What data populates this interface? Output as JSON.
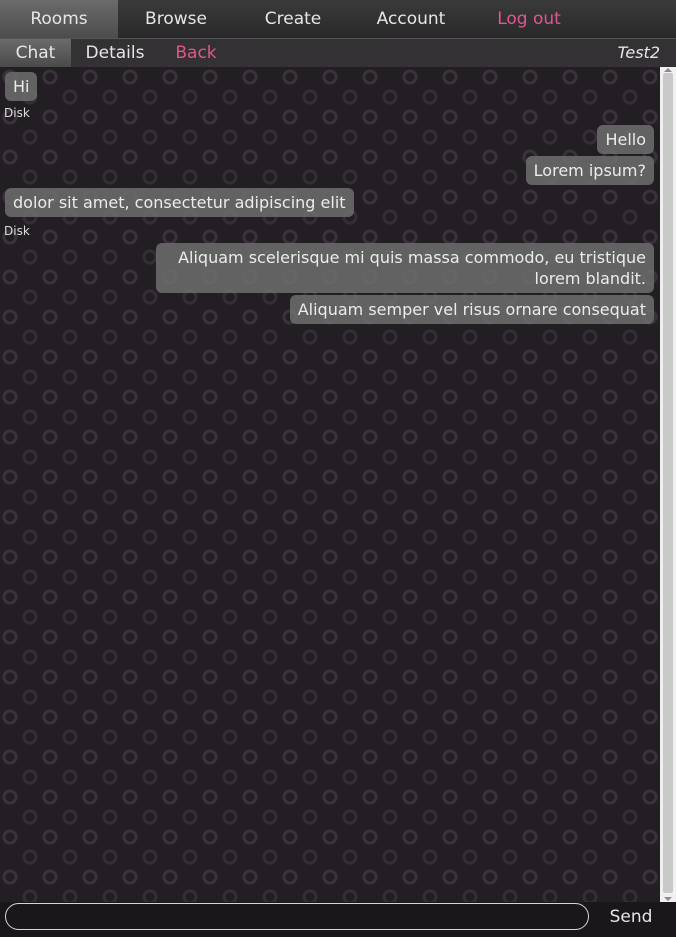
{
  "topnav": {
    "items": [
      "Rooms",
      "Browse",
      "Create",
      "Account"
    ],
    "logout_label": "Log out"
  },
  "subnav": {
    "chat_label": "Chat",
    "details_label": "Details",
    "back_label": "Back",
    "room_name": "Test2"
  },
  "messages": [
    {
      "text": "Hi",
      "side": "left",
      "sender": "Disk"
    },
    {
      "text": "Hello",
      "side": "right"
    },
    {
      "text": "Lorem ipsum?",
      "side": "right"
    },
    {
      "text": "dolor sit amet, consectetur adipiscing elit",
      "side": "left",
      "sender": "Disk"
    },
    {
      "text": "Aliquam scelerisque mi quis massa commodo, eu tristique lorem blandit.",
      "side": "right"
    },
    {
      "text": "Aliquam semper vel risus ornare consequat",
      "side": "right"
    }
  ],
  "input": {
    "placeholder": "",
    "send_label": "Send"
  },
  "colors": {
    "accent_pink": "#e0578f",
    "background": "#221d22",
    "bubble": "#6e6e6e"
  }
}
